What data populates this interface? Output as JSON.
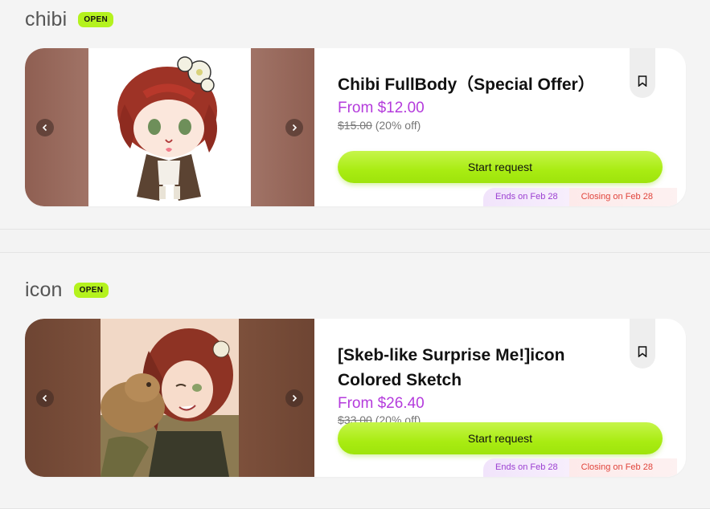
{
  "sections": [
    {
      "title": "chibi",
      "badge": "OPEN",
      "card": {
        "title": "Chibi FullBody（Special Offer）",
        "price": "From $12.00",
        "original_price": "$15.00",
        "discount": "(20% off)",
        "button": "Start request",
        "ends_tag": "Ends on Feb 28",
        "closing_tag": "Closing on Feb 28"
      }
    },
    {
      "title": "icon",
      "badge": "OPEN",
      "card": {
        "title_line1": "[Skeb-like Surprise Me!]icon",
        "title_line2": "Colored Sketch",
        "price": "From $26.40",
        "original_price": "$33.00",
        "discount": "(20% off)",
        "button": "Start request",
        "ends_tag": "Ends on Feb 28",
        "closing_tag": "Closing on Feb 28"
      }
    }
  ],
  "colors": {
    "accent_green": "#a9ec12",
    "price_purple": "#b43bdc",
    "closing_red": "#e0443b"
  },
  "icons": [
    "chevron-left-icon",
    "chevron-right-icon",
    "bookmark-icon"
  ]
}
